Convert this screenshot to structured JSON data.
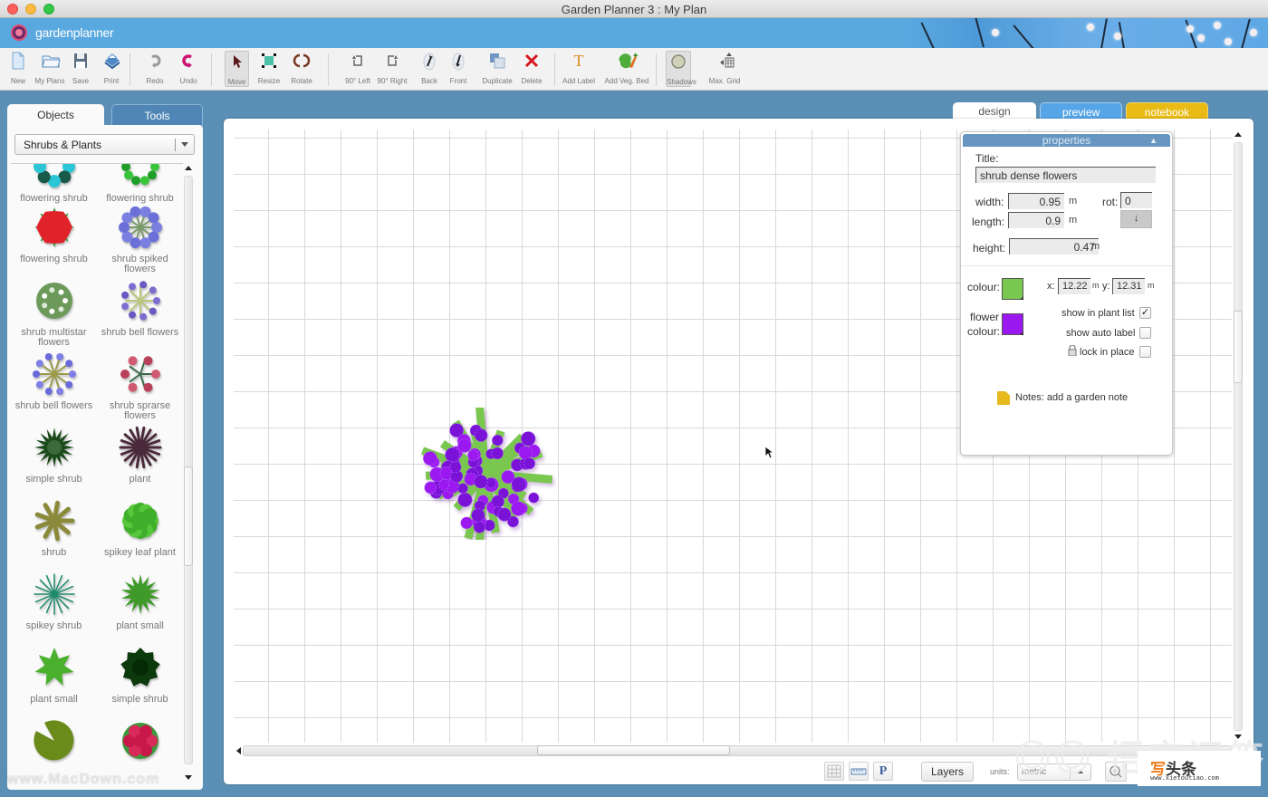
{
  "window": {
    "title": "Garden Planner 3 : My  Plan"
  },
  "brand": {
    "name": "gardenplanner"
  },
  "toolbar": {
    "groups": [
      [
        {
          "id": "new",
          "label": "New",
          "icon": "new-document-icon"
        },
        {
          "id": "my-plans",
          "label": "My Plans",
          "icon": "folder-icon"
        },
        {
          "id": "save",
          "label": "Save",
          "icon": "floppy-disk-icon"
        },
        {
          "id": "print",
          "label": "Print",
          "icon": "printer-icon"
        }
      ],
      [
        {
          "id": "redo",
          "label": "Redo",
          "icon": "redo-icon"
        },
        {
          "id": "undo",
          "label": "Undo",
          "icon": "undo-icon"
        }
      ],
      [
        {
          "id": "move",
          "label": "Move",
          "icon": "arrow-cursor-icon",
          "pressed": true
        },
        {
          "id": "resize",
          "label": "Resize",
          "icon": "resize-icon"
        },
        {
          "id": "rotate",
          "label": "Rotate",
          "icon": "rotate-icon"
        }
      ],
      [
        {
          "id": "rotate-left",
          "label": "90° Left",
          "icon": "rotate-left-icon"
        },
        {
          "id": "rotate-right",
          "label": "90° Right",
          "icon": "rotate-right-icon"
        },
        {
          "id": "back",
          "label": "Back",
          "icon": "send-back-icon"
        },
        {
          "id": "front",
          "label": "Front",
          "icon": "bring-front-icon"
        },
        {
          "id": "duplicate",
          "label": "Duplicate",
          "icon": "duplicate-icon"
        },
        {
          "id": "delete",
          "label": "Delete",
          "icon": "delete-x-icon"
        }
      ],
      [
        {
          "id": "add-label",
          "label": "Add Label",
          "icon": "text-t-icon"
        },
        {
          "id": "add-veg-bed",
          "label": "Add Veg. Bed",
          "icon": "vegetable-bed-icon"
        }
      ],
      [
        {
          "id": "shadows",
          "label": "Shadows",
          "icon": "shadow-circle-icon",
          "pressed": true
        },
        {
          "id": "max-grid",
          "label": "Max. Grid",
          "icon": "grid-expand-icon"
        }
      ]
    ]
  },
  "left_panel": {
    "tabs": [
      {
        "label": "Objects",
        "active": true
      },
      {
        "label": "Tools",
        "active": false
      }
    ],
    "category": "Shrubs & Plants",
    "objects": [
      {
        "name": "flowering shrub",
        "icon": "flowering-shrub-teal-icon"
      },
      {
        "name": "flowering shrub",
        "icon": "flowering-shrub-green-icon"
      },
      {
        "name": "flowering shrub",
        "icon": "flowering-shrub-red-icon"
      },
      {
        "name": "shrub spiked flowers",
        "icon": "shrub-spiked-flowers-icon"
      },
      {
        "name": "shrub multistar flowers",
        "icon": "shrub-multistar-flowers-icon"
      },
      {
        "name": "shrub bell flowers",
        "icon": "shrub-bell-flowers-purple-icon"
      },
      {
        "name": "shrub bell flowers",
        "icon": "shrub-bell-flowers-blue-icon"
      },
      {
        "name": "shrub sprarse flowers",
        "icon": "shrub-sparse-flowers-icon"
      },
      {
        "name": "simple shrub",
        "icon": "simple-shrub-dark-icon"
      },
      {
        "name": "plant",
        "icon": "plant-spiky-dark-icon"
      },
      {
        "name": "shrub",
        "icon": "shrub-olive-icon"
      },
      {
        "name": "spikey leaf plant",
        "icon": "spikey-leaf-plant-icon"
      },
      {
        "name": "spikey shrub",
        "icon": "spikey-shrub-icon"
      },
      {
        "name": "plant small",
        "icon": "plant-small-green-icon"
      },
      {
        "name": "plant small",
        "icon": "plant-small-star-icon"
      },
      {
        "name": "simple shrub",
        "icon": "simple-shrub-round-icon"
      },
      {
        "name": "",
        "icon": "lily-pad-icon"
      },
      {
        "name": "",
        "icon": "rose-bush-icon"
      }
    ]
  },
  "view_tabs": [
    {
      "label": "design",
      "active": true
    },
    {
      "label": "preview",
      "active": false
    },
    {
      "label": "notebook",
      "active": false
    }
  ],
  "canvas": {
    "selected_object": "shrub dense flowers"
  },
  "properties": {
    "header": "properties",
    "title_label": "Title:",
    "title_value": "shrub dense flowers",
    "width_label": "width:",
    "width_value": "0.95",
    "length_label": "length:",
    "length_value": "0.9",
    "height_label": "height:",
    "height_value": "0.47",
    "unit": "m",
    "rot_label": "rot:",
    "rot_value": "0",
    "rot_button": "↓",
    "colour_label": "colour:",
    "colour": "#7ac74f",
    "flower_colour_label_1": "flower",
    "flower_colour_label_2": "colour:",
    "flower_colour": "#9b19f0",
    "x_label": "x:",
    "x_value": "12.22",
    "y_label": "y:",
    "y_value": "12.31",
    "show_in_plant_list_label": "show in plant list",
    "show_in_plant_list": true,
    "show_auto_label_label": "show auto label",
    "show_auto_label": false,
    "lock_in_place_label": "lock in place",
    "lock_in_place": false,
    "notes_label": "Notes: add a garden note"
  },
  "bottom_bar": {
    "layers_label": "Layers",
    "units_label": "units:",
    "units_value": "metric",
    "p_button": "P"
  },
  "watermarks": {
    "left": "www.MacDown.com",
    "right_title_first": "写",
    "right_title_rest": "头条",
    "right_url": "www.xietoutiao.com"
  }
}
